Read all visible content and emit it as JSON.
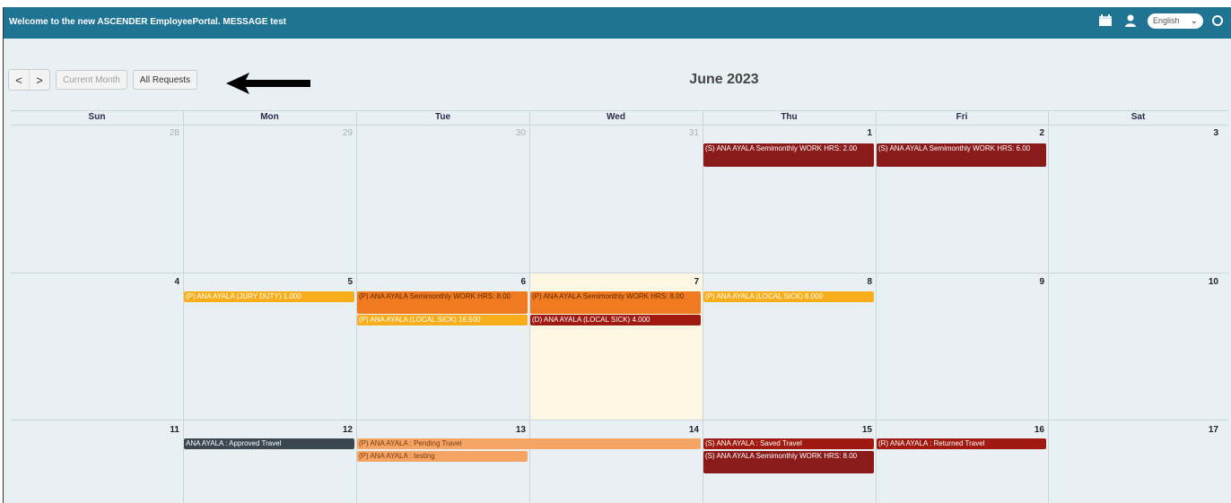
{
  "header": {
    "welcome": "Welcome to the new ASCENDER EmployeePortal. MESSAGE test",
    "language": "English",
    "icons": [
      "calendar-icon",
      "user-icon",
      "chevron-down-icon",
      "circle-icon"
    ]
  },
  "toolbar": {
    "prev": "<",
    "next": ">",
    "current_month": "Current Month",
    "all_requests": "All Requests"
  },
  "calendar": {
    "title": "June 2023",
    "weekdays": [
      "Sun",
      "Mon",
      "Tue",
      "Wed",
      "Thu",
      "Fri",
      "Sat"
    ],
    "weeks": [
      [
        "28",
        "29",
        "30",
        "31",
        "1",
        "2",
        "3"
      ],
      [
        "4",
        "5",
        "6",
        "7",
        "8",
        "9",
        "10"
      ],
      [
        "11",
        "12",
        "13",
        "14",
        "15",
        "16",
        "17"
      ]
    ],
    "events": [
      {
        "text": "(S) ANA AYALA Semimonthly WORK HRS: 2.00",
        "status": "saved"
      },
      {
        "text": "(S) ANA AYALA Semimonthly WORK HRS: 6.00",
        "status": "saved"
      },
      {
        "text": "(P) ANA AYALA (JURY DUTY) 1.000",
        "status": "pending-leave"
      },
      {
        "text": "(P) ANA AYALA Semimonthly WORK HRS: 8.00",
        "status": "pending"
      },
      {
        "text": "(P) ANA AYALA (LOCAL SICK) 16.500",
        "status": "pending-leave"
      },
      {
        "text": "(P) ANA AYALA Semimonthly WORK HRS: 8.00",
        "status": "pending"
      },
      {
        "text": "(D) ANA AYALA (LOCAL SICK) 4.000",
        "status": "denied"
      },
      {
        "text": "(P) ANA AYALA (LOCAL SICK) 8.000",
        "status": "pending-leave"
      },
      {
        "text": "ANA AYALA : Approved Travel",
        "status": "approved"
      },
      {
        "text": "(P) ANA AYALA : Pending Travel",
        "status": "pending-travel"
      },
      {
        "text": "(P) ANA AYALA : testing",
        "status": "pending-travel"
      },
      {
        "text": "(S) ANA AYALA : Saved Travel",
        "status": "saved"
      },
      {
        "text": "(S) ANA AYALA Semimonthly WORK HRS: 8.00",
        "status": "saved"
      },
      {
        "text": "(R) ANA AYALA : Returned Travel",
        "status": "returned"
      }
    ]
  }
}
